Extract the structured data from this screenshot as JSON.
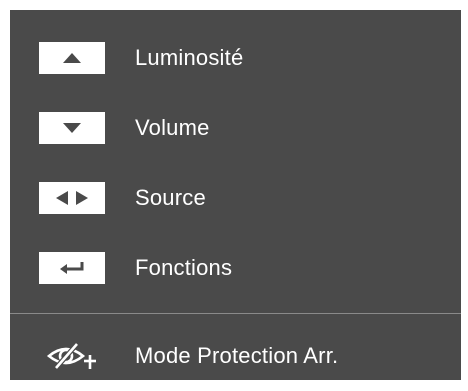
{
  "menu": {
    "items": [
      {
        "label": "Luminosité",
        "icon": "up-arrow-icon"
      },
      {
        "label": "Volume",
        "icon": "down-arrow-icon"
      },
      {
        "label": "Source",
        "icon": "left-right-arrows-icon"
      },
      {
        "label": "Fonctions",
        "icon": "enter-return-icon"
      }
    ],
    "footer": {
      "label": "Mode Protection Arr.",
      "icon": "eye-saver-icon"
    }
  },
  "colors": {
    "panel_background": "#4a4a4a",
    "text": "#ffffff",
    "button_background": "#ffffff",
    "button_icon": "#4a4a4a",
    "divider": "#8a8a8a"
  }
}
